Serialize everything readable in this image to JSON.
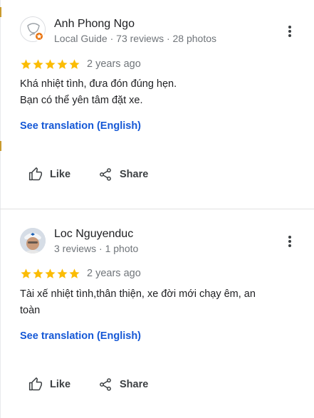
{
  "reviews": [
    {
      "name": "Anh Phong Ngo",
      "meta": "Local Guide · 73 reviews · 28 photos",
      "rating": 5,
      "date": "2 years ago",
      "lines": [
        "Khá nhiệt tình, đưa đón đúng hẹn.",
        "Bạn có thể yên tâm đặt xe."
      ],
      "translate_label": "See translation (English)",
      "like_label": "Like",
      "share_label": "Share"
    },
    {
      "name": "Loc Nguyenduc",
      "meta": "3 reviews · 1 photo",
      "rating": 5,
      "date": "2 years ago",
      "lines": [
        "Tài xế nhiệt tình,thân thiện, xe đời mới chạy êm, an",
        "toàn"
      ],
      "translate_label": "See translation (English)",
      "like_label": "Like",
      "share_label": "Share"
    }
  ],
  "colors": {
    "star": "#fbbc04",
    "link": "#1558d6",
    "badge": "#e8710a"
  },
  "icons": {
    "more": "more-vert-icon",
    "like": "thumb-up-icon",
    "share": "share-icon",
    "star": "star-icon"
  }
}
